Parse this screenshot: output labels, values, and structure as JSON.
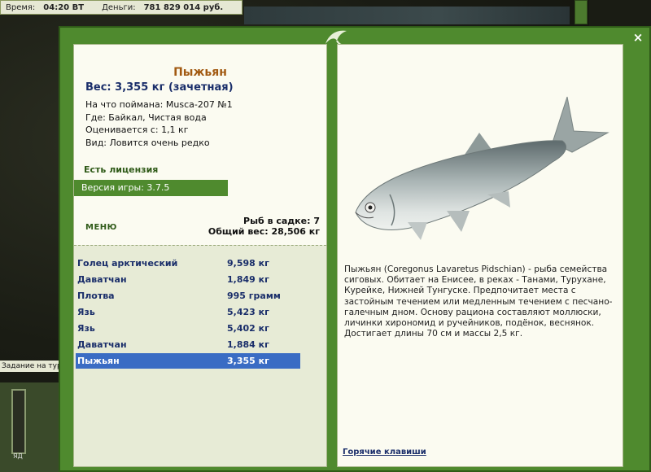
{
  "status_bar": {
    "time_label": "Время:",
    "time_value": "04:20 ВТ",
    "money_label": "Деньги:",
    "money_value": "781 829 014 руб."
  },
  "hud": {
    "task_label": "Задание на тур",
    "gauge_label": "ЯД"
  },
  "window": {
    "close_label": "×"
  },
  "fish_info": {
    "title": "Пыжьян",
    "weight_line": "Вес: 3,355 кг (зачетная)",
    "caught_with": "На что поймана: Musca-207 №1",
    "location": "Где: Байкал, Чистая вода",
    "rated_from": "Оценивается с: 1,1 кг",
    "rarity": "Вид: Ловится очень редко",
    "license": "Есть лицензия",
    "version": "Версия игры: 3.7.5"
  },
  "menu_label": "МЕНЮ",
  "cage": {
    "count_line": "Рыб в садке: 7",
    "total_line": "Общий вес: 28,506 кг"
  },
  "catch_list": [
    {
      "name": "Голец арктический",
      "weight": "9,598 кг"
    },
    {
      "name": "Даватчан",
      "weight": "1,849 кг"
    },
    {
      "name": "Плотва",
      "weight": "995 грамм"
    },
    {
      "name": "Язь",
      "weight": "5,423 кг"
    },
    {
      "name": "Язь",
      "weight": "5,402 кг"
    },
    {
      "name": "Даватчан",
      "weight": "1,884 кг"
    },
    {
      "name": "Пыжьян",
      "weight": "3,355 кг"
    }
  ],
  "selected_catch_index": 6,
  "description": "Пыжьян (Coregonus Lavaretus Pidschian) - рыба семейства сиговых. Обитает на Енисее, в реках - Танами, Турухане, Курейке, Нижней Тунгуске. Предпочитает места с застойным течением или медленным течением с песчано-галечным дном. Основу рациона составляют моллюски, личинки хирономид и ручейников, подёнок, веснянок. Достигает длины 70 см и массы 2,5 кг.",
  "hotkeys_label": "Горячие клавиши",
  "colors": {
    "frame_green": "#4f8a2e",
    "panel_bg": "#fbfbf1",
    "title_brown": "#a25a12",
    "text_navy": "#1a2e6a",
    "selected_row": "#3a6cc4"
  },
  "icons": {
    "logo": "leaping-fish-icon",
    "close": "close-icon"
  }
}
